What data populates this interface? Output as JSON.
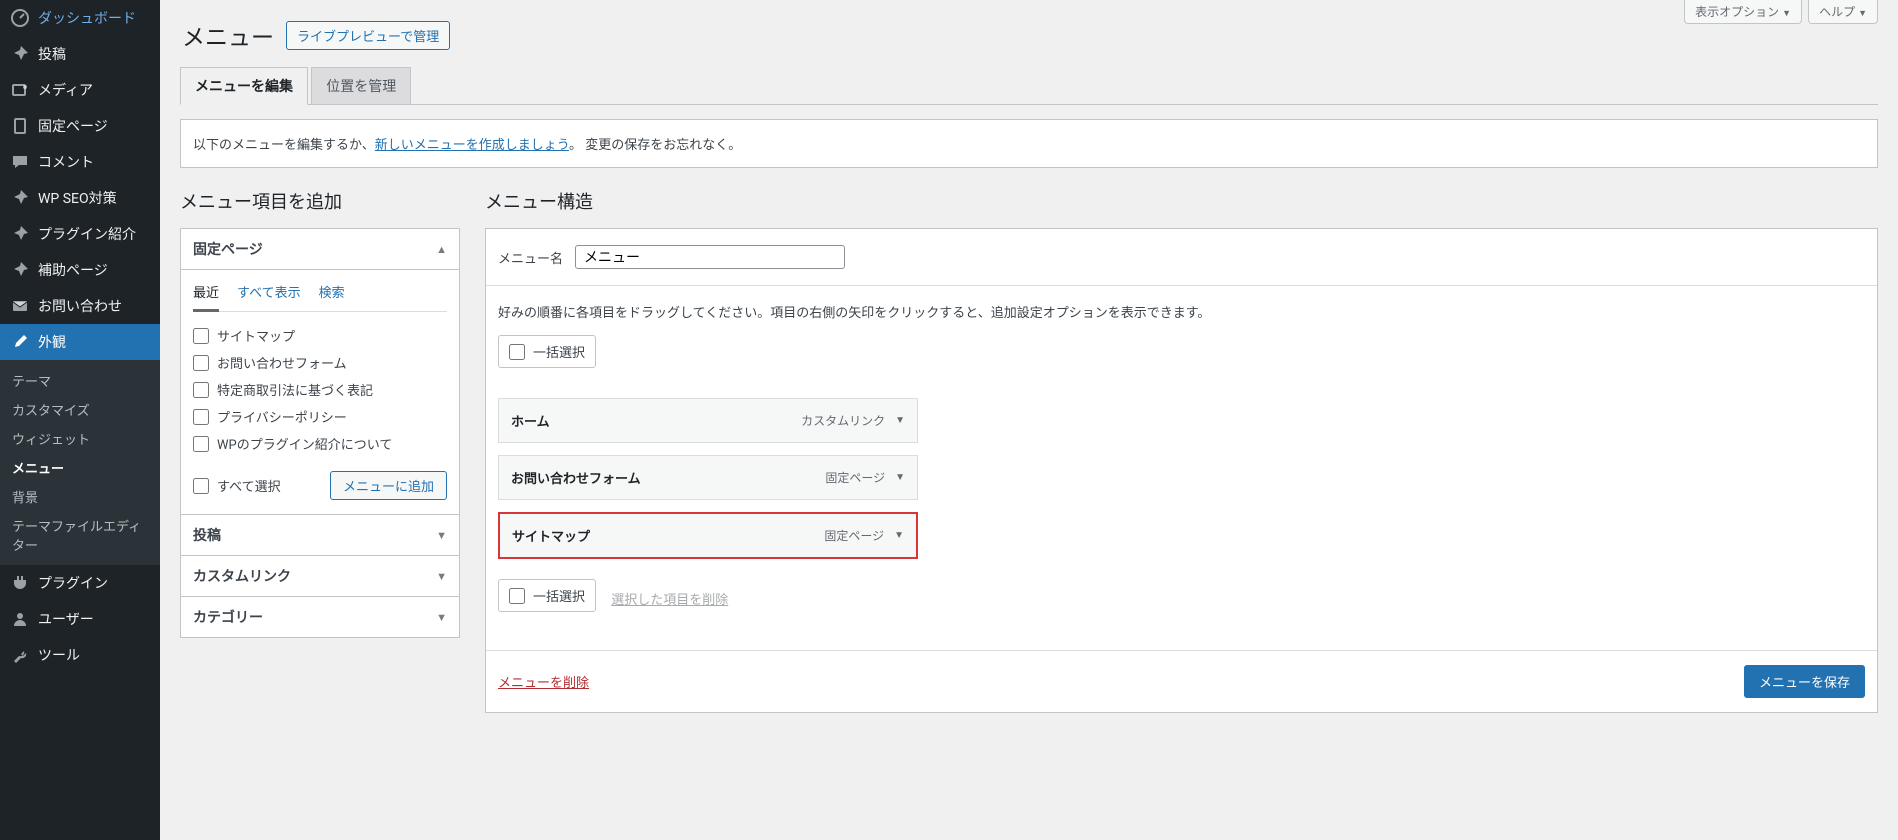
{
  "screen": {
    "options": "表示オプション",
    "help": "ヘルプ"
  },
  "sidebar": {
    "items": [
      {
        "icon": "dashboard-icon",
        "label": "ダッシュボード"
      },
      {
        "icon": "pin-icon",
        "label": "投稿"
      },
      {
        "icon": "media-icon",
        "label": "メディア"
      },
      {
        "icon": "page-icon",
        "label": "固定ページ"
      },
      {
        "icon": "comment-icon",
        "label": "コメント"
      },
      {
        "icon": "pin-icon",
        "label": "WP SEO対策"
      },
      {
        "icon": "pin-icon",
        "label": "プラグイン紹介"
      },
      {
        "icon": "pin-icon",
        "label": "補助ページ"
      },
      {
        "icon": "mail-icon",
        "label": "お問い合わせ"
      },
      {
        "icon": "brush-icon",
        "label": "外観",
        "current": true
      },
      {
        "icon": "plugin-icon",
        "label": "プラグイン"
      },
      {
        "icon": "user-icon",
        "label": "ユーザー"
      },
      {
        "icon": "tool-icon",
        "label": "ツール"
      }
    ],
    "submenu": [
      "テーマ",
      "カスタマイズ",
      "ウィジェット",
      "メニュー",
      "背景",
      "テーマファイルエディター"
    ],
    "submenu_current": "メニュー"
  },
  "page": {
    "title": "メニュー",
    "live_preview": "ライブプレビューで管理",
    "tabs": {
      "edit": "メニューを編集",
      "locations": "位置を管理"
    },
    "notice_before": "以下のメニューを編集するか、",
    "notice_link": "新しいメニューを作成しましょう",
    "notice_after": "。 変更の保存をお忘れなく。"
  },
  "add": {
    "heading": "メニュー項目を追加",
    "pages_label": "固定ページ",
    "inner_tabs": {
      "recent": "最近",
      "all": "すべて表示",
      "search": "検索"
    },
    "items": [
      "サイトマップ",
      "お問い合わせフォーム",
      "特定商取引法に基づく表記",
      "プライバシーポリシー",
      "WPのプラグイン紹介について"
    ],
    "select_all": "すべて選択",
    "add_button": "メニューに追加",
    "posts_label": "投稿",
    "custom_label": "カスタムリンク",
    "category_label": "カテゴリー"
  },
  "structure": {
    "heading": "メニュー構造",
    "name_label": "メニュー名",
    "name_value": "メニュー",
    "help": "好みの順番に各項目をドラッグしてください。項目の右側の矢印をクリックすると、追加設定オプションを表示できます。",
    "bulk_select": "一括選択",
    "bulk_remove": "選択した項目を削除",
    "items": [
      {
        "title": "ホーム",
        "type": "カスタムリンク"
      },
      {
        "title": "お問い合わせフォーム",
        "type": "固定ページ"
      },
      {
        "title": "サイトマップ",
        "type": "固定ページ",
        "highlight": true
      }
    ],
    "delete": "メニューを削除",
    "save": "メニューを保存"
  }
}
